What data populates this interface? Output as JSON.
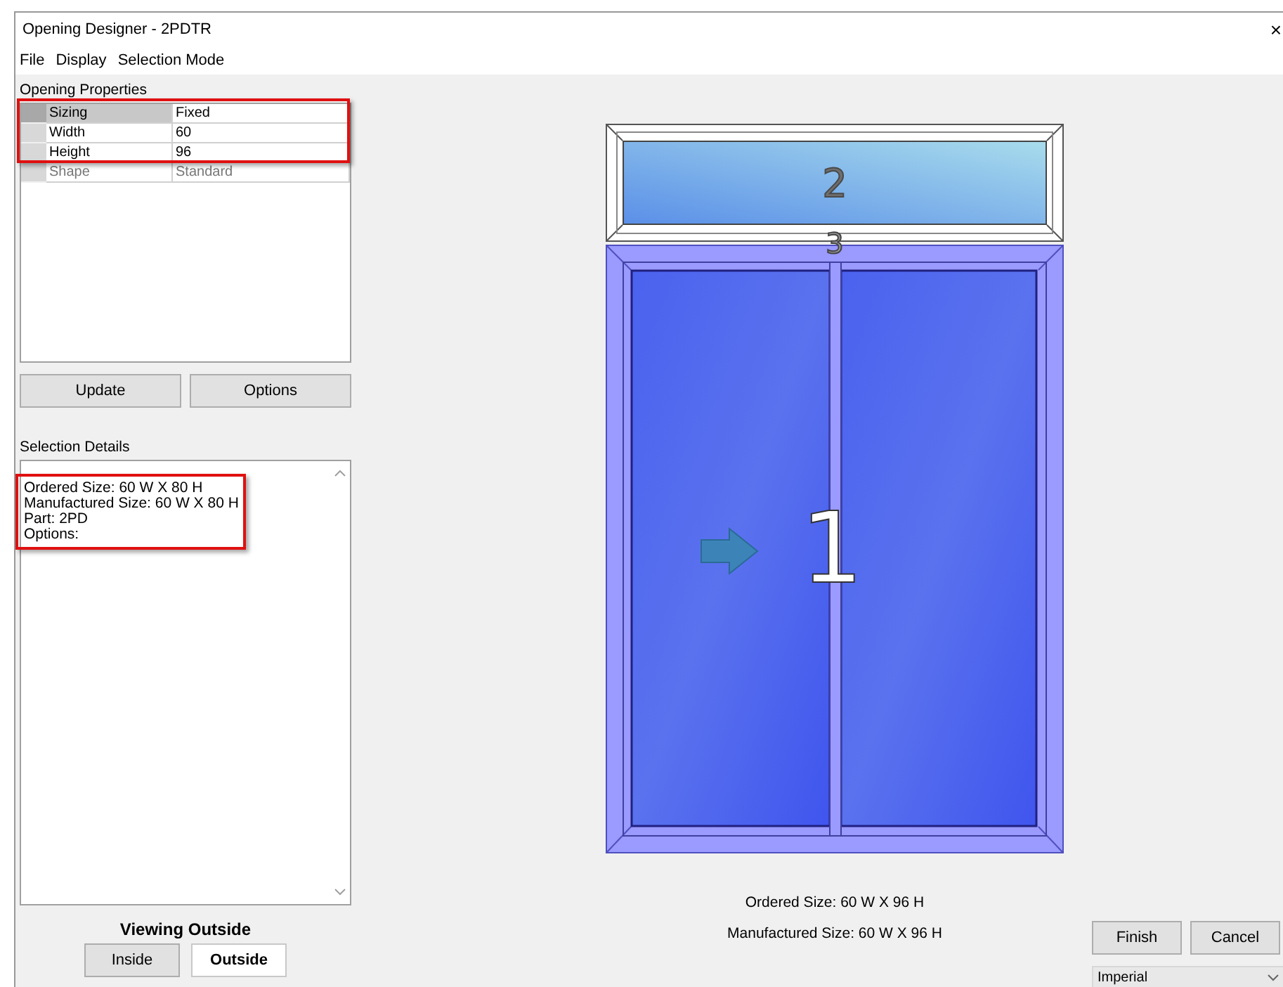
{
  "window": {
    "title": "Opening Designer - 2PDTR",
    "close": "×"
  },
  "menu": [
    {
      "label": "File"
    },
    {
      "label": "Display"
    },
    {
      "label": "Selection Mode"
    }
  ],
  "opening_properties": {
    "title": "Opening Properties",
    "rows": [
      {
        "name": "Sizing",
        "value": "Fixed",
        "selected": true,
        "disabled": false
      },
      {
        "name": "Width",
        "value": "60",
        "selected": false,
        "disabled": false
      },
      {
        "name": "Height",
        "value": "96",
        "selected": false,
        "disabled": false
      },
      {
        "name": "Shape",
        "value": "Standard",
        "selected": false,
        "disabled": true
      }
    ]
  },
  "property_buttons": [
    "Update",
    "Options"
  ],
  "selection_details": {
    "title": "Selection Details",
    "lines": [
      "Ordered Size: 60 W X 80 H",
      "Manufactured Size: 60 W X 80 H",
      "Part: 2PD",
      "Options:"
    ]
  },
  "view": {
    "title": "Viewing Outside",
    "buttons": [
      {
        "label": "Inside",
        "selected": false
      },
      {
        "label": "Outside",
        "selected": true
      }
    ]
  },
  "drawing": {
    "panels": [
      {
        "label": "2",
        "kind": "transom"
      },
      {
        "label": "3",
        "kind": "mullion"
      },
      {
        "label": "1",
        "kind": "door"
      }
    ]
  },
  "sizes": [
    "Ordered Size: 60 W X 96 H",
    "Manufactured Size: 60 W X 96 H"
  ],
  "actions": [
    "Finish",
    "Cancel"
  ],
  "units": {
    "value": "Imperial"
  }
}
